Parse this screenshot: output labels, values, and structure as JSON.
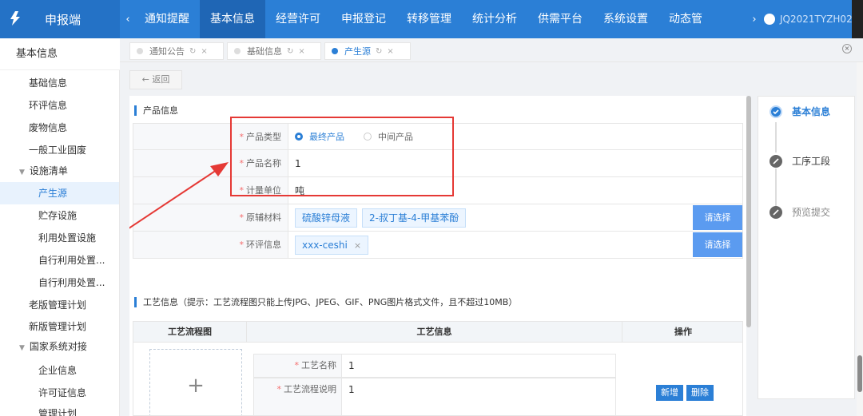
{
  "app": {
    "title": "申报端"
  },
  "nav": {
    "prev_arrow": "‹",
    "next_arrow": "›",
    "items": [
      {
        "label": "通知提醒"
      },
      {
        "label": "基本信息",
        "active": true
      },
      {
        "label": "经营许可"
      },
      {
        "label": "申报登记"
      },
      {
        "label": "转移管理"
      },
      {
        "label": "统计分析"
      },
      {
        "label": "供需平台"
      },
      {
        "label": "系统设置"
      },
      {
        "label": "动态管"
      }
    ],
    "user": "JQ2021TYZH02"
  },
  "sidebar": {
    "title": "基本信息",
    "items": [
      {
        "label": "基础信息"
      },
      {
        "label": "环评信息"
      },
      {
        "label": "废物信息"
      },
      {
        "label": "一般工业固废"
      },
      {
        "label": "设施清单",
        "expandable": true
      },
      {
        "label": "产生源",
        "active": true
      },
      {
        "label": "贮存设施"
      },
      {
        "label": "利用处置设施"
      },
      {
        "label": "自行利用处置..."
      },
      {
        "label": "自行利用处置..."
      },
      {
        "label": "老版管理计划"
      },
      {
        "label": "新版管理计划"
      },
      {
        "label": "国家系统对接",
        "expandable": true
      },
      {
        "label": "企业信息"
      },
      {
        "label": "许可证信息"
      },
      {
        "label": "管理计划"
      }
    ]
  },
  "tabs": [
    {
      "label": "通知公告",
      "refresh": "↻",
      "close": "×"
    },
    {
      "label": "基础信息",
      "refresh": "↻",
      "close": "×"
    },
    {
      "label": "产生源",
      "refresh": "↻",
      "close": "×",
      "active": true
    }
  ],
  "back_label": "← 返回",
  "product": {
    "section_title": "产品信息",
    "type_label": "产品类型",
    "type_options": [
      "最终产品",
      "中间产品"
    ],
    "type_selected": "最终产品",
    "name_label": "产品名称",
    "name_value": "1",
    "unit_label": "计量单位",
    "unit_value": "吨",
    "materials_label": "原辅材料",
    "materials": [
      "硫酸锌母液",
      "2-叔丁基-4-甲基苯酚"
    ],
    "eia_label": "环评信息",
    "eia_tags": [
      "xxx-ceshi"
    ],
    "tag_remove": "×",
    "select_button": "请选择",
    "required_mark": "*"
  },
  "craft": {
    "section_title": "工艺信息（提示：工艺流程图只能上传JPG、JPEG、GIF、PNG图片格式文件，且不超过10MB）",
    "col_flowchart": "工艺流程图",
    "col_info": "工艺信息",
    "col_ops": "操作",
    "upload_symbol": "+",
    "name_label": "工艺名称",
    "name_value": "1",
    "desc_label": "工艺流程说明",
    "desc_value": "1",
    "add_button": "新增",
    "delete_button": "删除"
  },
  "steps": [
    {
      "label": "基本信息",
      "state": "active"
    },
    {
      "label": "工序工段",
      "state": "pending"
    },
    {
      "label": "预览提交",
      "state": "dim"
    }
  ],
  "colors": {
    "primary": "#2b7fd6",
    "highlight": "#e53935"
  }
}
